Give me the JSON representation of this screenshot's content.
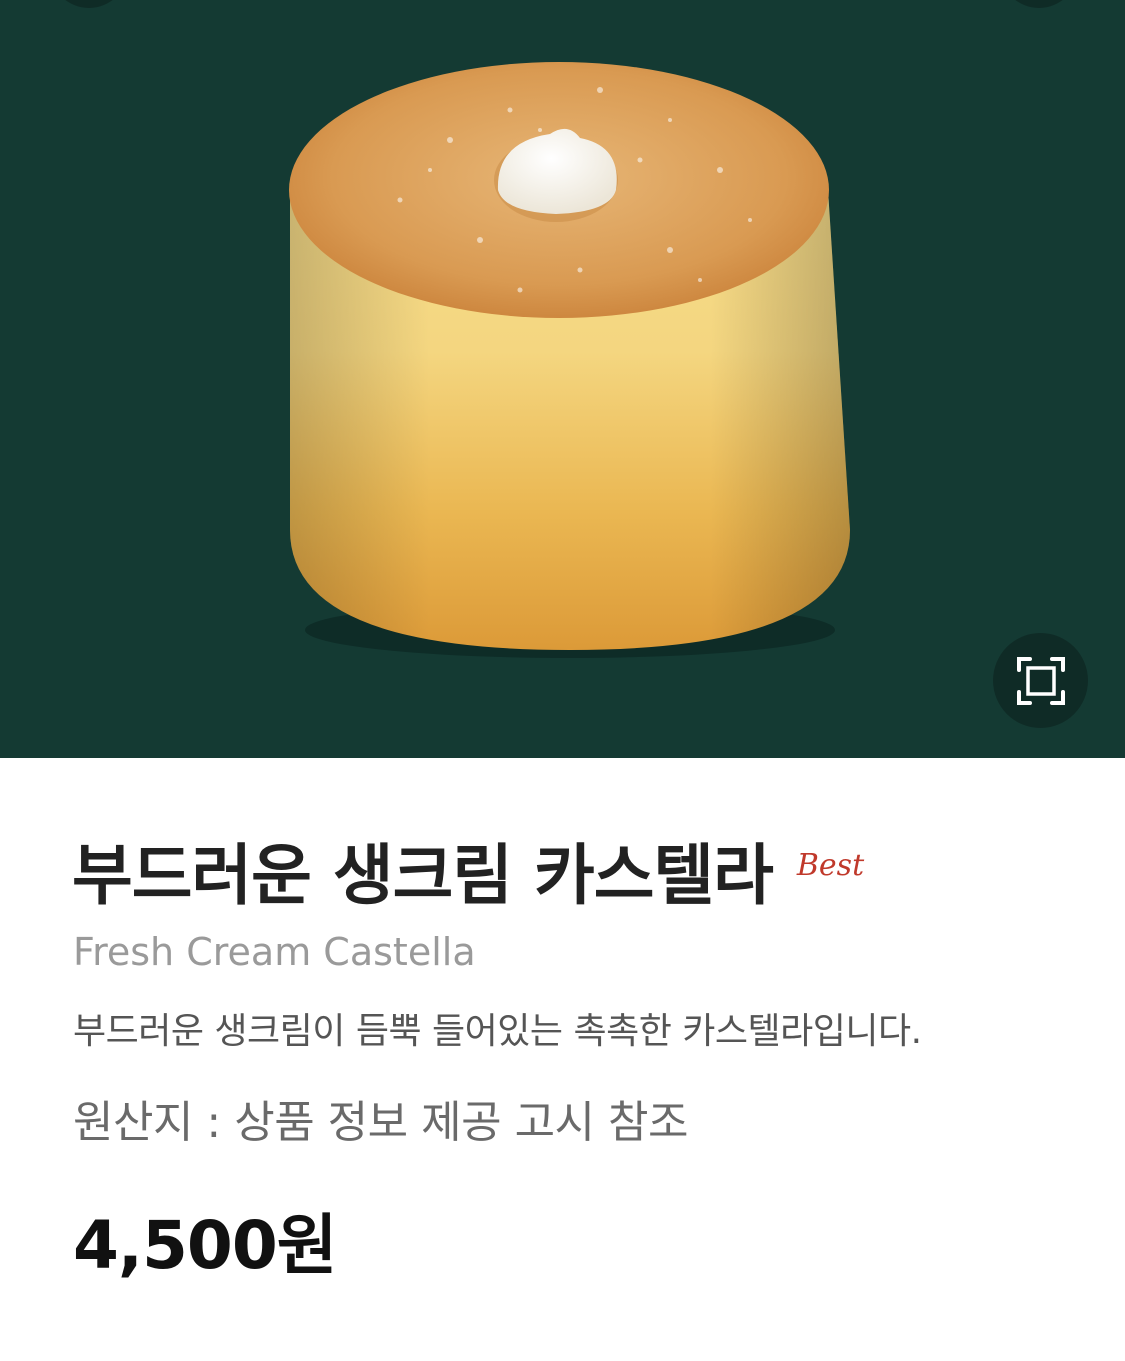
{
  "hero": {
    "image_label": "Fresh Cream Castella product photo",
    "background_color": "#143a33",
    "expand_icon": "fullscreen-corners-icon"
  },
  "product": {
    "title_ko": "부드러운 생크림 카스텔라",
    "badge": "Best",
    "badge_color": "#c0392b",
    "name_en": "Fresh Cream Castella",
    "description": "부드러운 생크림이 듬뿍 들어있는 촉촉한 카스텔라입니다.",
    "origin": "원산지 : 상품 정보 제공 고시 참조",
    "price": "4,500원"
  }
}
